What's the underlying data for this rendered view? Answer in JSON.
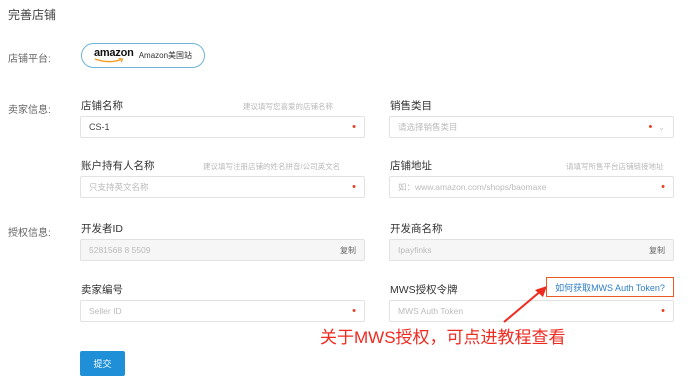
{
  "page": {
    "title": "完善店铺"
  },
  "platform": {
    "label": "店铺平台:",
    "logo_text": "amazon",
    "name": "Amazon美国站"
  },
  "seller": {
    "section_label": "卖家信息:",
    "shop_name": {
      "label": "店铺名称",
      "hint": "建议填写您喜爱的店铺名称",
      "value": "CS-1"
    },
    "category": {
      "label": "销售类目",
      "placeholder": "请选择销售类目"
    },
    "account_holder": {
      "label": "账户持有人名称",
      "hint": "建议填写注册店铺的姓名拼音/公司英文名",
      "placeholder": "只支持英文名称"
    },
    "shop_url": {
      "label": "店铺地址",
      "hint": "请填写所售平台店铺链接地址",
      "placeholder": "如：www.amazon.com/shops/baomaxe"
    }
  },
  "auth": {
    "section_label": "授权信息:",
    "developer_id": {
      "label": "开发者ID",
      "value": "5281568 8 5509",
      "copy_label": "复制"
    },
    "developer_name": {
      "label": "开发商名称",
      "value": "Ipayfinks",
      "copy_label": "复制"
    },
    "seller_id": {
      "label": "卖家编号",
      "placeholder": "Seller ID"
    },
    "mws_token": {
      "label": "MWS授权令牌",
      "placeholder": "MWS Auth Token"
    },
    "help_link": "如何获取MWS Auth Token?"
  },
  "submit_label": "提交",
  "annotation": "关于MWS授权，可点进教程查看",
  "colors": {
    "primary": "#1f90d8",
    "required": "#e4411f",
    "annotation": "#ef2a1f",
    "pill_border": "#6fb4d8",
    "link": "#2f7fc6"
  }
}
